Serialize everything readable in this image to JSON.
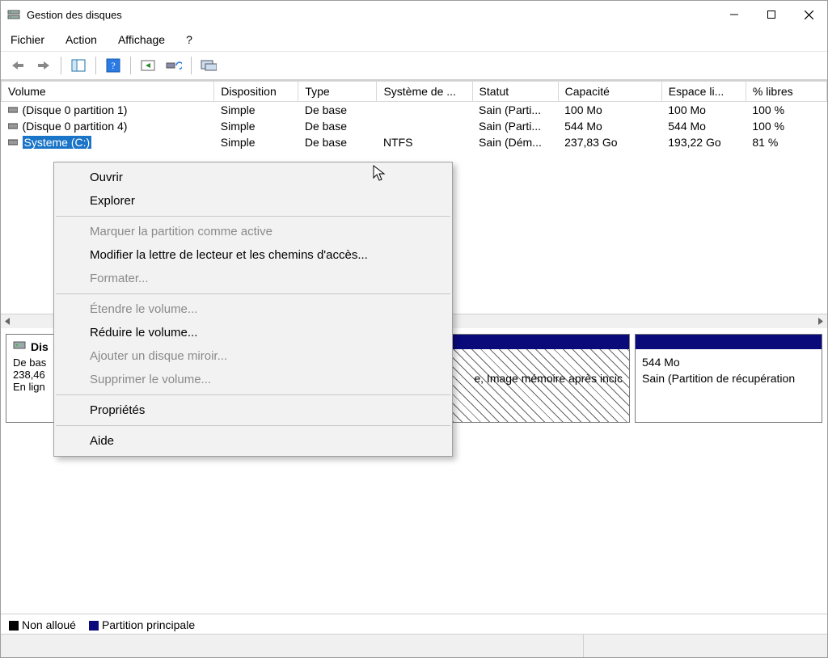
{
  "window": {
    "title": "Gestion des disques"
  },
  "menubar": {
    "file": "Fichier",
    "action": "Action",
    "view": "Affichage",
    "help": "?"
  },
  "columns": {
    "volume": "Volume",
    "disposition": "Disposition",
    "type": "Type",
    "filesystem": "Système de ...",
    "status": "Statut",
    "capacity": "Capacité",
    "free": "Espace li...",
    "pctfree": "% libres"
  },
  "volumes": [
    {
      "name": "(Disque 0 partition 1)",
      "disposition": "Simple",
      "type": "De base",
      "fs": "",
      "status": "Sain (Parti...",
      "capacity": "100 Mo",
      "free": "100 Mo",
      "pctfree": "100 %"
    },
    {
      "name": "(Disque 0 partition 4)",
      "disposition": "Simple",
      "type": "De base",
      "fs": "",
      "status": "Sain (Parti...",
      "capacity": "544 Mo",
      "free": "544 Mo",
      "pctfree": "100 %"
    },
    {
      "name": "Systeme (C:)",
      "disposition": "Simple",
      "type": "De base",
      "fs": "NTFS",
      "status": "Sain (Dém...",
      "capacity": "237,83 Go",
      "free": "193,22 Go",
      "pctfree": "81 %"
    }
  ],
  "contextmenu": {
    "open": "Ouvrir",
    "explore": "Explorer",
    "mark_active": "Marquer la partition comme active",
    "change_letter": "Modifier la lettre de lecteur et les chemins d'accès...",
    "format": "Formater...",
    "extend": "Étendre le volume...",
    "shrink": "Réduire le volume...",
    "mirror": "Ajouter un disque miroir...",
    "delete": "Supprimer le volume...",
    "properties": "Propriétés",
    "help": "Aide"
  },
  "disk": {
    "heading": "Dis",
    "type": "De bas",
    "capacity": "238,46",
    "state": "En lign"
  },
  "partitions": {
    "p_selected_text": "e, Image mémoire après incic",
    "p_recovery_size": "544 Mo",
    "p_recovery_status": "Sain (Partition de récupération"
  },
  "legend": {
    "unallocated": "Non alloué",
    "primary": "Partition principale"
  }
}
